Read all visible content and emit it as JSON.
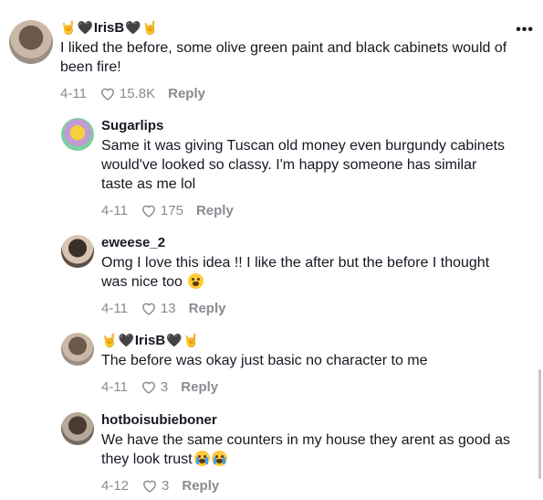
{
  "comments": [
    {
      "username": "IrisB",
      "text": "I liked the before, some olive green paint and black cabinets would of been fire!",
      "date": "4-11",
      "likes": "15.8K",
      "reply": "Reply"
    },
    {
      "username": "Sugarlips",
      "text": "Same it was giving Tuscan old money even burgundy cabinets would've looked so classy. I'm happy someone has similar taste as me lol",
      "date": "4-11",
      "likes": "175",
      "reply": "Reply"
    },
    {
      "username": "eweese_2",
      "text": "Omg I love this idea !! I like the after but the before I thought was nice too",
      "date": "4-11",
      "likes": "13",
      "reply": "Reply"
    },
    {
      "username": "IrisB",
      "text": "The before was okay just basic no character to me",
      "date": "4-11",
      "likes": "3",
      "reply": "Reply"
    },
    {
      "username": "hotboisubieboner",
      "text": "We have the same counters in my house they arent as good as they look trust",
      "date": "4-12",
      "likes": "3",
      "reply": "Reply"
    }
  ],
  "icons": {
    "more": "more-icon",
    "heart": "heart-icon"
  },
  "colors": {
    "meta_gray": "#8a8b91",
    "text": "#161823"
  }
}
